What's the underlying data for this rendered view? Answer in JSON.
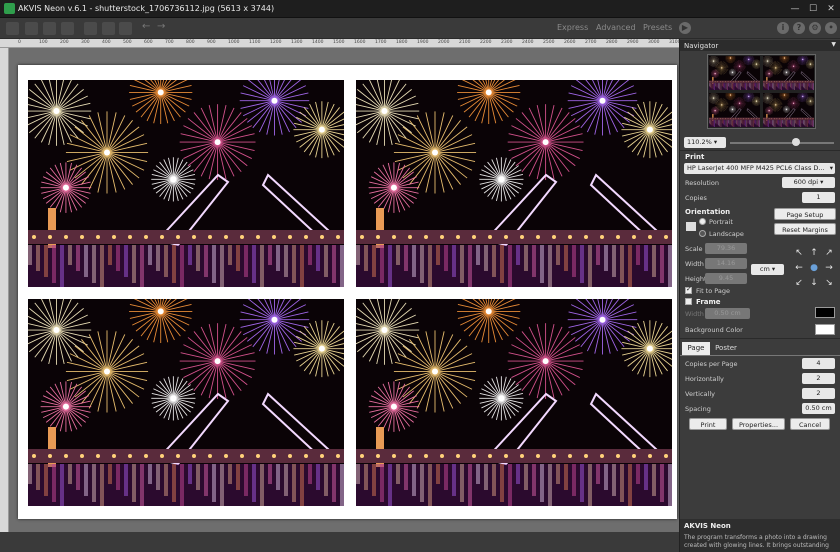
{
  "window": {
    "title": "AKVIS Neon v.6.1 - shutterstock_1706736112.jpg (5613 x 3744)"
  },
  "toolbar": {
    "modes": [
      "Express",
      "Advanced",
      "Presets"
    ]
  },
  "ruler": {
    "ticks": [
      "0",
      "100",
      "200",
      "300",
      "400",
      "500",
      "600",
      "700",
      "800",
      "900",
      "1000",
      "1100",
      "1200",
      "1300",
      "1400",
      "1500",
      "1600",
      "1700",
      "1800",
      "1900",
      "2000",
      "2100",
      "2200",
      "2300",
      "2400",
      "2500",
      "2600",
      "2700",
      "2800",
      "2900",
      "3000",
      "3100"
    ]
  },
  "navigator": {
    "title": "Navigator",
    "zoom": "110.2%",
    "zoom_fraction": 0.6
  },
  "print": {
    "section": "Print",
    "printer": "HP LaserJet 400 MFP M425 PCL6 Class D...",
    "resolution_label": "Resolution",
    "resolution_value": "600 dpi",
    "copies_label": "Copies",
    "copies_value": "1",
    "orientation_label": "Orientation",
    "portrait": "Portrait",
    "landscape": "Landscape",
    "page_setup": "Page Setup",
    "reset_margins": "Reset Margins",
    "scale_label": "Scale",
    "scale_value": "79.36",
    "width_label": "Width",
    "width_value": "14.16",
    "height_label": "Height",
    "height_value": "9.45",
    "unit": "cm",
    "fit_to_page": "Fit to Page",
    "frame": "Frame",
    "frame_width_label": "Width",
    "frame_width_value": "0.50 cm",
    "frame_color": "#000000",
    "background_color_label": "Background Color",
    "background_color": "#ffffff"
  },
  "tabs": [
    "Page",
    "Poster"
  ],
  "page": {
    "copies_per_page_label": "Copies per Page",
    "copies_per_page": "4",
    "horizontally_label": "Horizontally",
    "horizontally": "2",
    "vertically_label": "Vertically",
    "vertically": "2",
    "spacing_label": "Spacing",
    "spacing": "0.50 cm"
  },
  "buttons": {
    "print": "Print",
    "properties": "Properties...",
    "cancel": "Cancel"
  },
  "info": {
    "title": "AKVIS Neon",
    "text": "The program transforms a photo into a drawing created with glowing lines. It brings outstanding"
  }
}
